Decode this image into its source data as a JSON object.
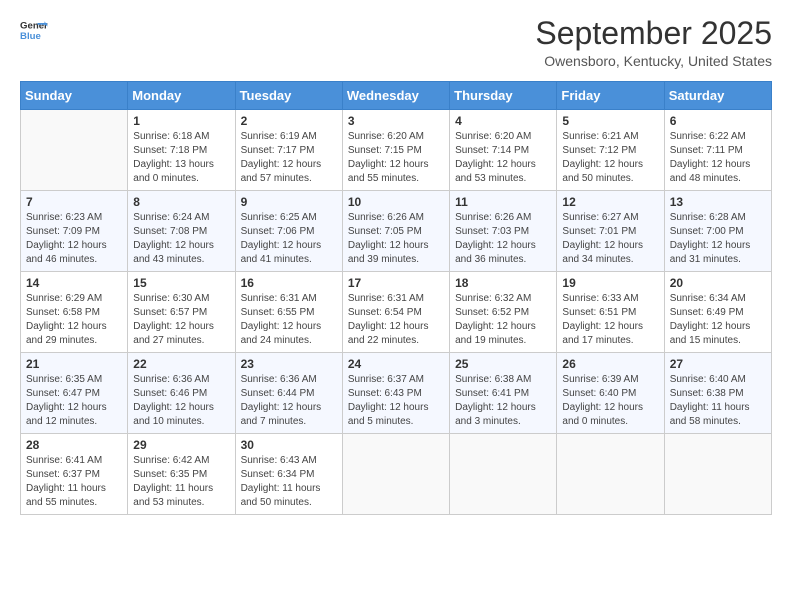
{
  "header": {
    "logo_general": "General",
    "logo_blue": "Blue",
    "month": "September 2025",
    "location": "Owensboro, Kentucky, United States"
  },
  "days_of_week": [
    "Sunday",
    "Monday",
    "Tuesday",
    "Wednesday",
    "Thursday",
    "Friday",
    "Saturday"
  ],
  "weeks": [
    [
      {
        "day": "",
        "info": ""
      },
      {
        "day": "1",
        "info": "Sunrise: 6:18 AM\nSunset: 7:18 PM\nDaylight: 13 hours\nand 0 minutes."
      },
      {
        "day": "2",
        "info": "Sunrise: 6:19 AM\nSunset: 7:17 PM\nDaylight: 12 hours\nand 57 minutes."
      },
      {
        "day": "3",
        "info": "Sunrise: 6:20 AM\nSunset: 7:15 PM\nDaylight: 12 hours\nand 55 minutes."
      },
      {
        "day": "4",
        "info": "Sunrise: 6:20 AM\nSunset: 7:14 PM\nDaylight: 12 hours\nand 53 minutes."
      },
      {
        "day": "5",
        "info": "Sunrise: 6:21 AM\nSunset: 7:12 PM\nDaylight: 12 hours\nand 50 minutes."
      },
      {
        "day": "6",
        "info": "Sunrise: 6:22 AM\nSunset: 7:11 PM\nDaylight: 12 hours\nand 48 minutes."
      }
    ],
    [
      {
        "day": "7",
        "info": "Sunrise: 6:23 AM\nSunset: 7:09 PM\nDaylight: 12 hours\nand 46 minutes."
      },
      {
        "day": "8",
        "info": "Sunrise: 6:24 AM\nSunset: 7:08 PM\nDaylight: 12 hours\nand 43 minutes."
      },
      {
        "day": "9",
        "info": "Sunrise: 6:25 AM\nSunset: 7:06 PM\nDaylight: 12 hours\nand 41 minutes."
      },
      {
        "day": "10",
        "info": "Sunrise: 6:26 AM\nSunset: 7:05 PM\nDaylight: 12 hours\nand 39 minutes."
      },
      {
        "day": "11",
        "info": "Sunrise: 6:26 AM\nSunset: 7:03 PM\nDaylight: 12 hours\nand 36 minutes."
      },
      {
        "day": "12",
        "info": "Sunrise: 6:27 AM\nSunset: 7:01 PM\nDaylight: 12 hours\nand 34 minutes."
      },
      {
        "day": "13",
        "info": "Sunrise: 6:28 AM\nSunset: 7:00 PM\nDaylight: 12 hours\nand 31 minutes."
      }
    ],
    [
      {
        "day": "14",
        "info": "Sunrise: 6:29 AM\nSunset: 6:58 PM\nDaylight: 12 hours\nand 29 minutes."
      },
      {
        "day": "15",
        "info": "Sunrise: 6:30 AM\nSunset: 6:57 PM\nDaylight: 12 hours\nand 27 minutes."
      },
      {
        "day": "16",
        "info": "Sunrise: 6:31 AM\nSunset: 6:55 PM\nDaylight: 12 hours\nand 24 minutes."
      },
      {
        "day": "17",
        "info": "Sunrise: 6:31 AM\nSunset: 6:54 PM\nDaylight: 12 hours\nand 22 minutes."
      },
      {
        "day": "18",
        "info": "Sunrise: 6:32 AM\nSunset: 6:52 PM\nDaylight: 12 hours\nand 19 minutes."
      },
      {
        "day": "19",
        "info": "Sunrise: 6:33 AM\nSunset: 6:51 PM\nDaylight: 12 hours\nand 17 minutes."
      },
      {
        "day": "20",
        "info": "Sunrise: 6:34 AM\nSunset: 6:49 PM\nDaylight: 12 hours\nand 15 minutes."
      }
    ],
    [
      {
        "day": "21",
        "info": "Sunrise: 6:35 AM\nSunset: 6:47 PM\nDaylight: 12 hours\nand 12 minutes."
      },
      {
        "day": "22",
        "info": "Sunrise: 6:36 AM\nSunset: 6:46 PM\nDaylight: 12 hours\nand 10 minutes."
      },
      {
        "day": "23",
        "info": "Sunrise: 6:36 AM\nSunset: 6:44 PM\nDaylight: 12 hours\nand 7 minutes."
      },
      {
        "day": "24",
        "info": "Sunrise: 6:37 AM\nSunset: 6:43 PM\nDaylight: 12 hours\nand 5 minutes."
      },
      {
        "day": "25",
        "info": "Sunrise: 6:38 AM\nSunset: 6:41 PM\nDaylight: 12 hours\nand 3 minutes."
      },
      {
        "day": "26",
        "info": "Sunrise: 6:39 AM\nSunset: 6:40 PM\nDaylight: 12 hours\nand 0 minutes."
      },
      {
        "day": "27",
        "info": "Sunrise: 6:40 AM\nSunset: 6:38 PM\nDaylight: 11 hours\nand 58 minutes."
      }
    ],
    [
      {
        "day": "28",
        "info": "Sunrise: 6:41 AM\nSunset: 6:37 PM\nDaylight: 11 hours\nand 55 minutes."
      },
      {
        "day": "29",
        "info": "Sunrise: 6:42 AM\nSunset: 6:35 PM\nDaylight: 11 hours\nand 53 minutes."
      },
      {
        "day": "30",
        "info": "Sunrise: 6:43 AM\nSunset: 6:34 PM\nDaylight: 11 hours\nand 50 minutes."
      },
      {
        "day": "",
        "info": ""
      },
      {
        "day": "",
        "info": ""
      },
      {
        "day": "",
        "info": ""
      },
      {
        "day": "",
        "info": ""
      }
    ]
  ]
}
